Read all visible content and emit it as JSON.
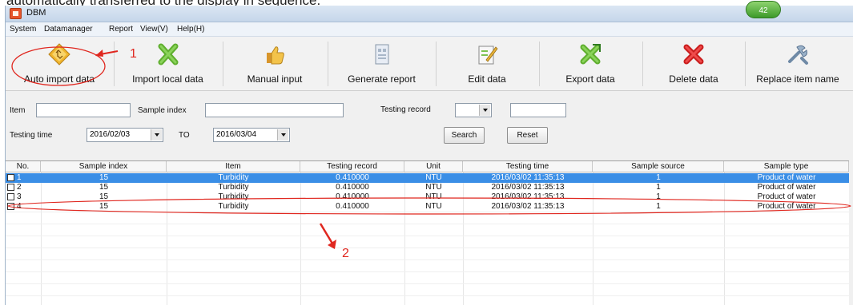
{
  "header_text": "automatically transferred to the display in sequence.",
  "window": {
    "title": "DBM",
    "badge": "42"
  },
  "menu": [
    "System",
    "Datamanager",
    "Report",
    "View(V)",
    "Help(H)"
  ],
  "toolbar": [
    {
      "label": "Auto import data",
      "icon": "auto-import-icon"
    },
    {
      "label": "Import local data",
      "icon": "import-local-icon"
    },
    {
      "label": "Manual input",
      "icon": "manual-input-icon"
    },
    {
      "label": "Generate report",
      "icon": "generate-report-icon"
    },
    {
      "label": "Edit data",
      "icon": "edit-data-icon"
    },
    {
      "label": "Export data",
      "icon": "export-data-icon"
    },
    {
      "label": "Delete data",
      "icon": "delete-data-icon"
    },
    {
      "label": "Replace item name",
      "icon": "replace-item-icon"
    }
  ],
  "filters": {
    "item_label": "Item",
    "item_value": "",
    "sample_index_label": "Sample index",
    "sample_index_value": "",
    "testing_record_label": "Testing record",
    "testing_record_op": "",
    "testing_record_value": "",
    "testing_time_label": "Testing time",
    "date_from": "2016/02/03",
    "to_label": "TO",
    "date_to": "2016/03/04",
    "search_label": "Search",
    "reset_label": "Reset"
  },
  "table": {
    "columns": [
      "No.",
      "Sample index",
      "Item",
      "Testing record",
      "Unit",
      "Testing time",
      "Sample source",
      "Sample type"
    ],
    "rows": [
      {
        "no": "1",
        "sample_index": "15",
        "item": "Turbidity",
        "testing_record": "0.410000",
        "unit": "NTU",
        "testing_time": "2016/03/02 11:35:13",
        "sample_source": "1",
        "sample_type": "Product of water"
      },
      {
        "no": "2",
        "sample_index": "15",
        "item": "Turbidity",
        "testing_record": "0.410000",
        "unit": "NTU",
        "testing_time": "2016/03/02 11:35:13",
        "sample_source": "1",
        "sample_type": "Product of water"
      },
      {
        "no": "3",
        "sample_index": "15",
        "item": "Turbidity",
        "testing_record": "0.410000",
        "unit": "NTU",
        "testing_time": "2016/03/02 11:35:13",
        "sample_source": "1",
        "sample_type": "Product of water"
      },
      {
        "no": "4",
        "sample_index": "15",
        "item": "Turbidity",
        "testing_record": "0.410000",
        "unit": "NTU",
        "testing_time": "2016/03/02 11:35:13",
        "sample_source": "1",
        "sample_type": "Product of water"
      }
    ],
    "selected_row": 0
  },
  "annotations": {
    "marker_1": "1",
    "marker_2": "2",
    "color": "#e0271f"
  },
  "colors": {
    "selection": "#3a8ee6",
    "titlebar": "#c5d6ea"
  }
}
